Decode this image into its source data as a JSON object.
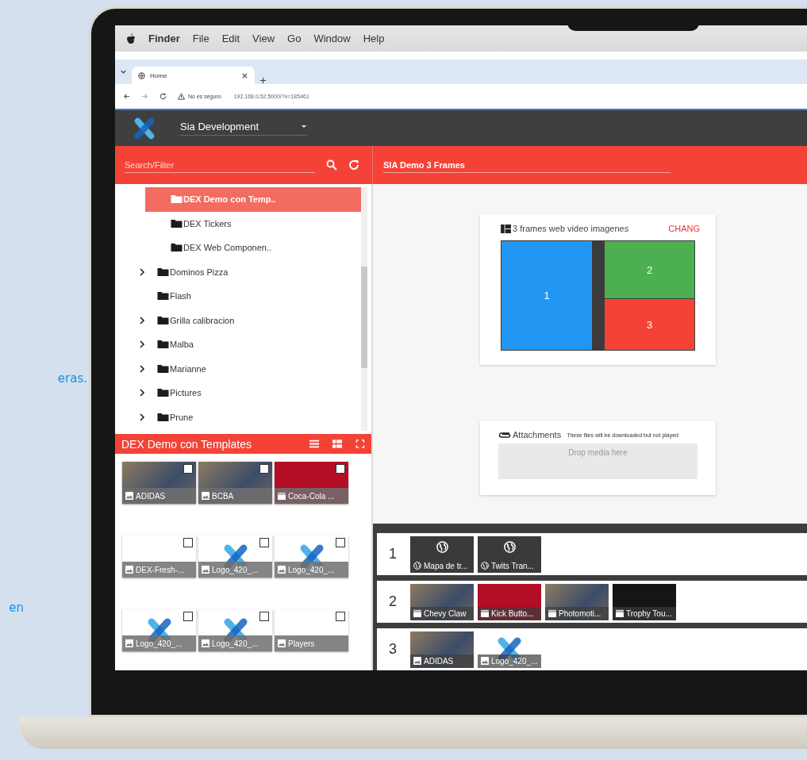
{
  "side_text": [
    "eras.",
    "en"
  ],
  "menubar": {
    "app": "Finder",
    "items": [
      "File",
      "Edit",
      "View",
      "Go",
      "Window",
      "Help"
    ]
  },
  "browser": {
    "tab": "Home",
    "security": "No es seguro",
    "url": "192.168.0.52:5000/?v=185461"
  },
  "app_header": {
    "workspace": "Sia Development"
  },
  "search": {
    "placeholder": "Search/Filter"
  },
  "title_field": {
    "value": "SIA Demo 3 Frames"
  },
  "tree": [
    {
      "children": [
        {
          "label": "DEX Demo con Temp..",
          "selected": true
        },
        {
          "label": "DEX Tickers",
          "selected": false
        },
        {
          "label": "DEX Web Componen..",
          "selected": false
        }
      ]
    },
    {
      "label": "Dominos Pizza",
      "selected": false,
      "expandable": true
    },
    {
      "label": "Flash",
      "selected": false,
      "expandable": false
    },
    {
      "label": "Grilla calibracion",
      "selected": false,
      "expandable": true
    },
    {
      "label": "Malba",
      "selected": false,
      "expandable": true
    },
    {
      "label": "Marianne",
      "selected": false,
      "expandable": true
    },
    {
      "label": "Pictures",
      "selected": false,
      "expandable": true
    },
    {
      "label": "Prune",
      "selected": false,
      "expandable": true
    }
  ],
  "folder_panel": {
    "title": "DEX Demo con Templates",
    "media": [
      {
        "label": "ADIDAS",
        "kind": "photo",
        "checked": false
      },
      {
        "label": "BCBA",
        "kind": "photo",
        "checked": false
      },
      {
        "label": "Coca-Cola ...",
        "kind": "clip",
        "checked": false
      },
      {
        "label": "DEX-Fresh-...",
        "kind": "graphic",
        "checked": false
      },
      {
        "label": "Logo_420_...",
        "kind": "logo",
        "checked": false
      },
      {
        "label": "Logo_420_...",
        "kind": "logo",
        "checked": false
      },
      {
        "label": "Logo_420_...",
        "kind": "logo",
        "checked": false
      },
      {
        "label": "Logo_420_...",
        "kind": "logo",
        "checked": false
      },
      {
        "label": "Players",
        "kind": "graphic",
        "checked": false
      }
    ]
  },
  "layout_card": {
    "title": "3 frames web video imagenes",
    "action": "CHANG",
    "frames": [
      {
        "label": "1",
        "color": "#2196f3"
      },
      {
        "label": "2",
        "color": "#4caf50"
      },
      {
        "label": "3",
        "color": "#f44336"
      }
    ]
  },
  "attachments": {
    "title": "Attachments",
    "note": "These files will be downloaded but not played",
    "drop": "Drop media here"
  },
  "playlist": [
    {
      "number": "1",
      "items": [
        {
          "label": "Mapa de tr...",
          "kind": "web"
        },
        {
          "label": "Twits Tran...",
          "kind": "web"
        }
      ]
    },
    {
      "number": "2",
      "items": [
        {
          "label": "Chevy Claw",
          "kind": "footage"
        },
        {
          "label": "Kick Butto...",
          "kind": "clip"
        },
        {
          "label": "Photomoti...",
          "kind": "footage"
        },
        {
          "label": "Trophy Tou...",
          "kind": "reel"
        }
      ]
    },
    {
      "number": "3",
      "items": [
        {
          "label": "ADIDAS",
          "kind": "photo"
        },
        {
          "label": "Logo_420_...",
          "kind": "logo"
        }
      ]
    }
  ]
}
